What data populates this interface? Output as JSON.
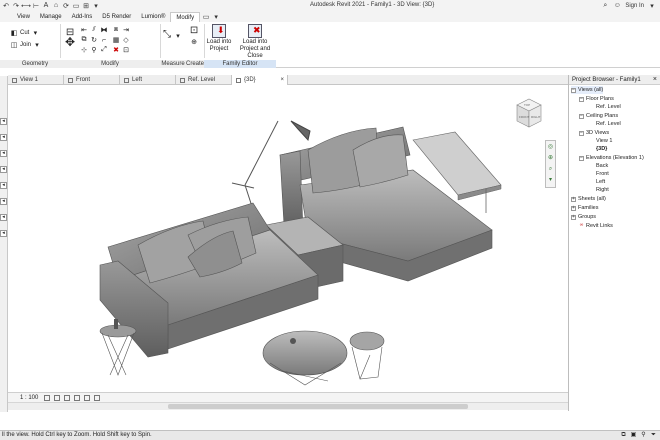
{
  "window": {
    "title": "Autodesk Revit 2021 - Family1 - 3D View: {3D}",
    "sign_in": "Sign In"
  },
  "ribbon": {
    "tabs": [
      "View",
      "Manage",
      "Add-Ins",
      "D5 Render",
      "Lumion®",
      "Modify"
    ],
    "active_tab": "Modify",
    "clipboard": {
      "cut_label": "Cut",
      "join_label": "Join"
    },
    "panels": {
      "geometry": "Geometry",
      "modify": "Modify",
      "measure": "Measure",
      "create": "Create",
      "family_editor": "Family Editor"
    },
    "buttons": {
      "load_into_project": "Load into\nProject",
      "load_into_project_close": "Load into\nProject and Close"
    }
  },
  "view_tabs": [
    {
      "label": "View 1",
      "active": false
    },
    {
      "label": "Front",
      "active": false
    },
    {
      "label": "Left",
      "active": false
    },
    {
      "label": "Ref. Level",
      "active": false
    },
    {
      "label": "{3D}",
      "active": true
    }
  ],
  "viewport": {
    "scale": "1 : 100",
    "viewcube_labels": {
      "top": "TOP",
      "front": "FRONT",
      "right": "RIGHT"
    }
  },
  "project_browser": {
    "title": "Project Browser - Family1",
    "tree": [
      {
        "label": "Views (all)",
        "level": 0,
        "toggle": "-",
        "icon": "views"
      },
      {
        "label": "Floor Plans",
        "level": 1,
        "toggle": "-"
      },
      {
        "label": "Ref. Level",
        "level": 2
      },
      {
        "label": "Ceiling Plans",
        "level": 1,
        "toggle": "-"
      },
      {
        "label": "Ref. Level",
        "level": 2
      },
      {
        "label": "3D Views",
        "level": 1,
        "toggle": "-"
      },
      {
        "label": "View 1",
        "level": 2
      },
      {
        "label": "{3D}",
        "level": 2,
        "selected": true
      },
      {
        "label": "Elevations (Elevation 1)",
        "level": 1,
        "toggle": "-"
      },
      {
        "label": "Back",
        "level": 2
      },
      {
        "label": "Front",
        "level": 2
      },
      {
        "label": "Left",
        "level": 2
      },
      {
        "label": "Right",
        "level": 2
      },
      {
        "label": "Sheets (all)",
        "level": 0,
        "toggle": "+"
      },
      {
        "label": "Families",
        "level": 0,
        "toggle": "+"
      },
      {
        "label": "Groups",
        "level": 0,
        "toggle": "+"
      },
      {
        "label": "Revit Links",
        "level": 0
      }
    ]
  },
  "status_bar": {
    "text": "ll the view. Hold Ctrl key to Zoom. Hold Shift key to Spin."
  },
  "colors": {
    "accent": "#2b6cb0",
    "model_gray": "#8c8c8c",
    "family_editor_panel": "#d6e4f5"
  }
}
